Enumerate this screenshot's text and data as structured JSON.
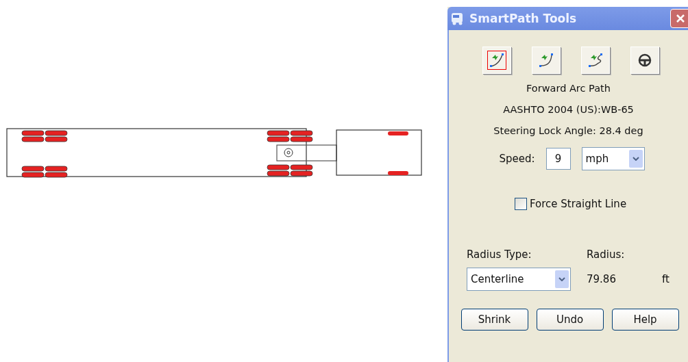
{
  "window": {
    "title": "SmartPath Tools"
  },
  "tools": [
    {
      "kind": "arc",
      "selected": true
    },
    {
      "kind": "curve",
      "selected": false
    },
    {
      "kind": "loop",
      "selected": false
    },
    {
      "kind": "wheel",
      "selected": false
    }
  ],
  "info": [
    "Forward Arc Path",
    "AASHTO 2004 (US):WB-65",
    "Steering Lock Angle: 28.4 deg"
  ],
  "speed": {
    "label": "Speed:",
    "value": "9",
    "unit": "mph"
  },
  "force_straight_line": {
    "label": "Force Straight Line",
    "checked": false
  },
  "radius_type": {
    "label": "Radius Type:",
    "value": "Centerline"
  },
  "radius": {
    "label": "Radius:",
    "value": "79.86",
    "unit": "ft"
  },
  "buttons": [
    "Shrink",
    "Undo",
    "Help"
  ]
}
